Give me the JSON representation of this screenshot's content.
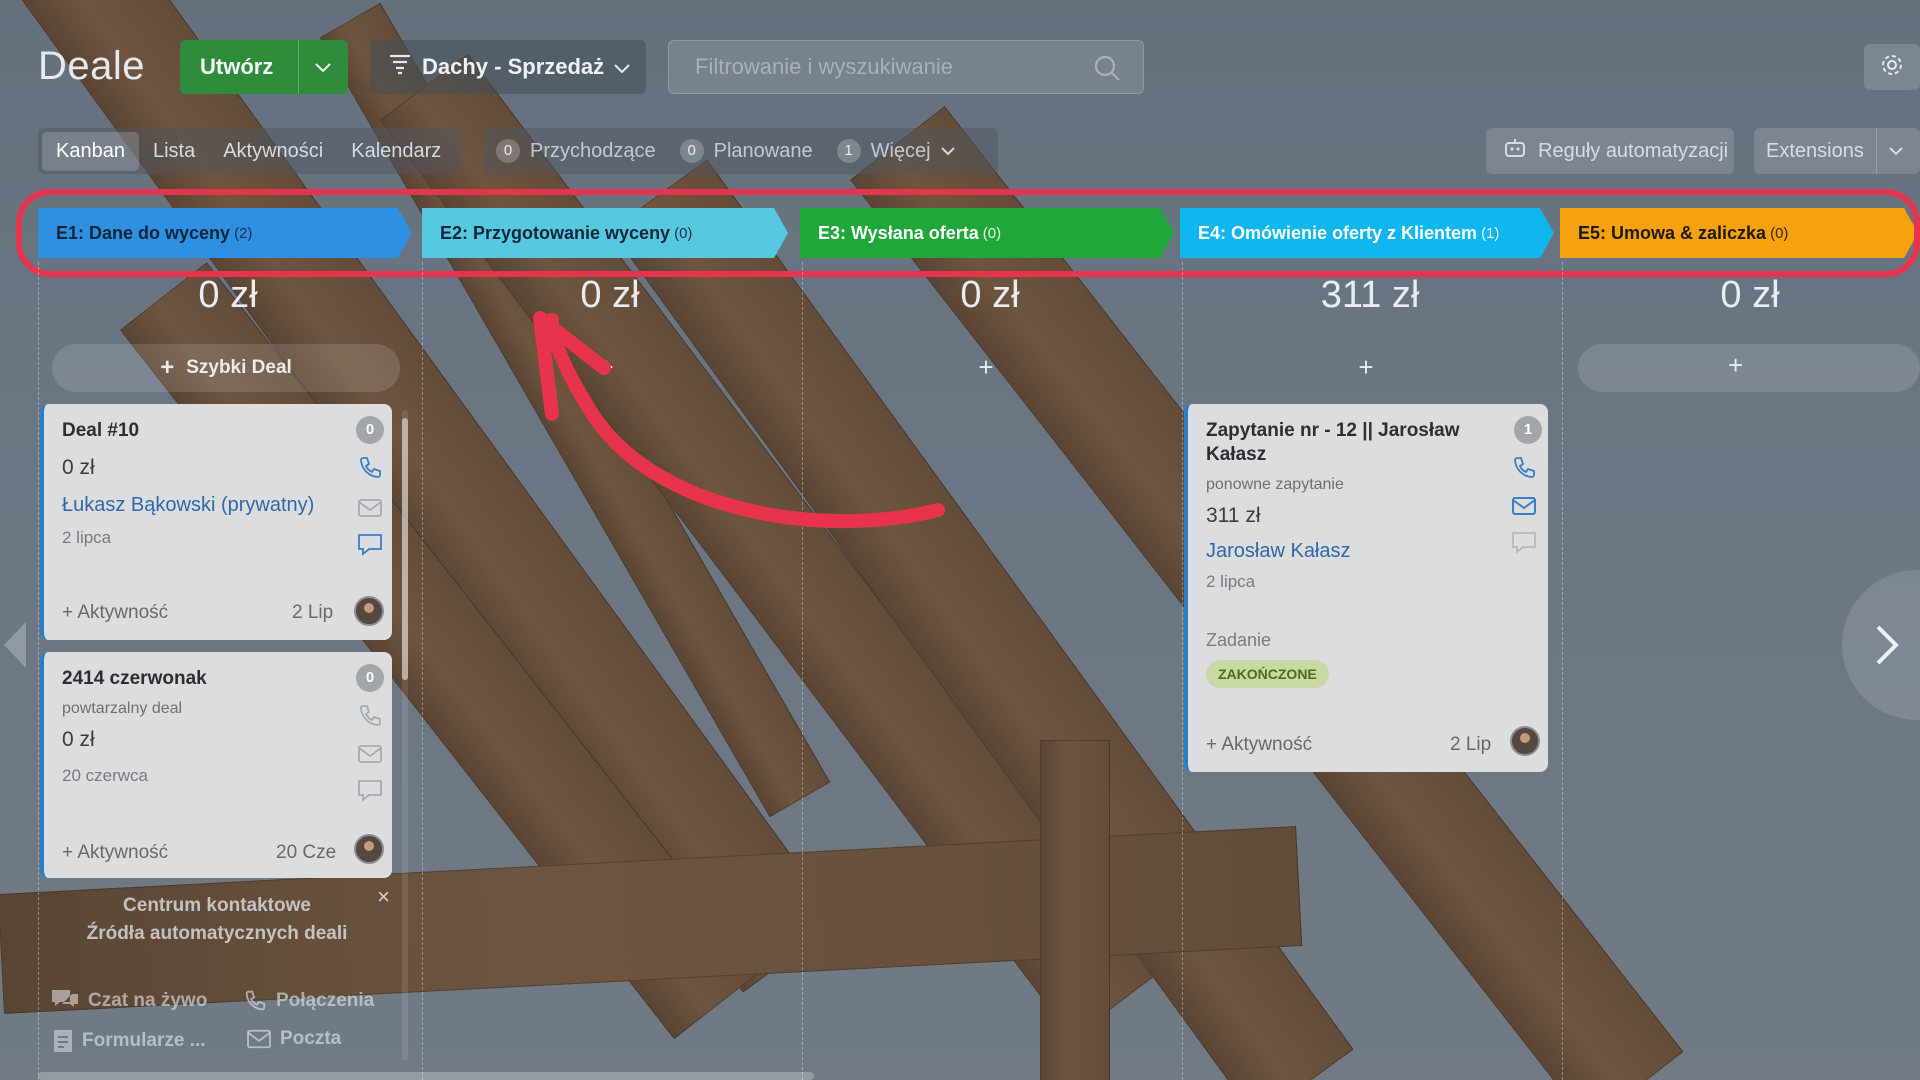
{
  "header": {
    "title": "Deale",
    "create_label": "Utwórz",
    "pipeline_label": "Dachy - Sprzedaż",
    "search_placeholder": "Filtrowanie i wyszukiwanie"
  },
  "views": [
    "Kanban",
    "Lista",
    "Aktywności",
    "Kalendarz"
  ],
  "active_view": "Kanban",
  "counters": [
    {
      "count": "0",
      "label": "Przychodzące"
    },
    {
      "count": "0",
      "label": "Planowane"
    },
    {
      "count": "1",
      "label": "Więcej"
    }
  ],
  "automation_label": "Reguły automatyzacji",
  "extensions_label": "Extensions",
  "stages": [
    {
      "name": "E1: Dane do wyceny",
      "count": "(2)",
      "color": "#2f8fe0",
      "text_color": "#14263a",
      "sum": "0 zł"
    },
    {
      "name": "E2: Przygotowanie wyceny",
      "count": "(0)",
      "color": "#56c9e0",
      "text_color": "#14263a",
      "sum": "0 zł"
    },
    {
      "name": "E3: Wysłana oferta",
      "count": "(0)",
      "color": "#1fa83a",
      "text_color": "#ffffff",
      "sum": "0 zł"
    },
    {
      "name": "E4: Omówienie oferty z Klientem",
      "count": "(1)",
      "color": "#10b6ee",
      "text_color": "#ffffff",
      "sum": "311 zł"
    },
    {
      "name": "E5: Umowa & zaliczka",
      "count": "(0)",
      "color": "#f6a20e",
      "text_color": "#1f1a10",
      "sum": "0 zł"
    }
  ],
  "quick_deal_label": "Szybki Deal",
  "cards": {
    "deal10": {
      "title": "Deal #10",
      "badge": "0",
      "amount": "0 zł",
      "contact": "Łukasz Bąkowski (prywatny)",
      "date": "2 lipca",
      "activity_label": "+ Aktywność",
      "activity_date": "2 Lip"
    },
    "deal2414": {
      "title": "2414 czerwonak",
      "badge": "0",
      "subtitle": "powtarzalny deal",
      "amount": "0 zł",
      "date": "20 czerwca",
      "activity_label": "+ Aktywność",
      "activity_date": "20 Cze"
    },
    "zapytanie": {
      "title_line1": "Zapytanie nr - 12 || Jarosław",
      "title_line2": "Kałasz",
      "badge": "1",
      "subtitle": "ponowne zapytanie",
      "amount": "311 zł",
      "contact": "Jarosław Kałasz",
      "date": "2 lipca",
      "task_label": "Zadanie",
      "task_status": "ZAKOŃCZONE",
      "activity_label": "+ Aktywność",
      "activity_date": "2 Lip"
    }
  },
  "contact_center": {
    "line1": "Centrum kontaktowe",
    "line2": "Źródła automatycznych deali",
    "items": [
      "Czat na żywo",
      "Połączenia",
      "Formularze ...",
      "Poczta"
    ]
  },
  "colors": {
    "highlight": "#e8334f",
    "create_button": "#2f8c3b",
    "tag_bg": "#c8d9a3"
  },
  "icons": [
    "gear-icon",
    "search-icon",
    "filter-icon",
    "phone-icon",
    "mail-icon",
    "chat-icon",
    "robot-icon",
    "close-icon",
    "chevron-right-icon",
    "arrow-annotation"
  ]
}
